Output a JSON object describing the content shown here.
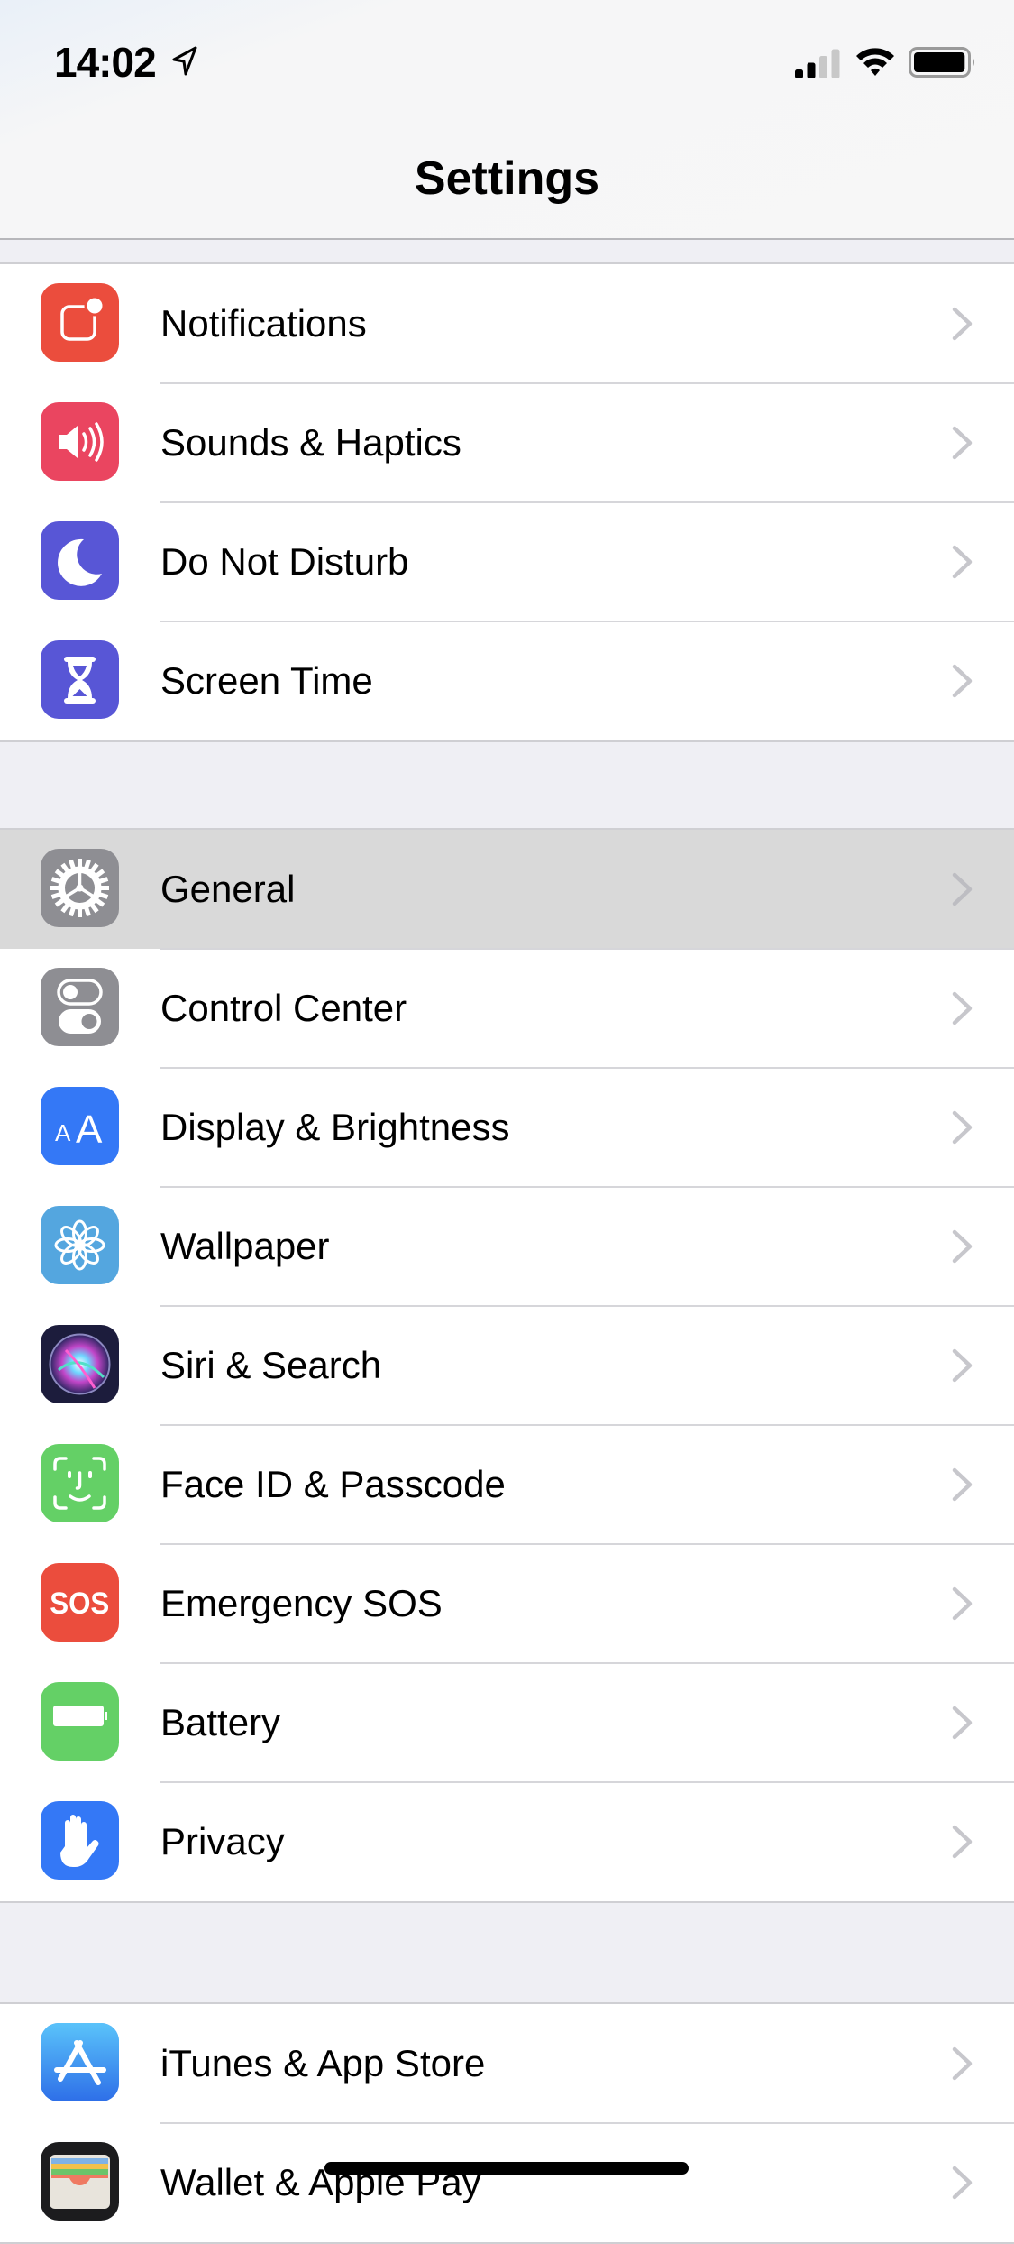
{
  "status_bar": {
    "time": "14:02",
    "location_icon": "location-arrow-icon",
    "signal_bars_active": 2,
    "signal_bars_total": 4,
    "wifi_icon": "wifi-icon",
    "battery_level": 0.9
  },
  "header": {
    "title": "Settings"
  },
  "colors": {
    "background": "#efeff4",
    "highlight": "#d9d9d9",
    "chevron": "#c7c7cc"
  },
  "groups": [
    {
      "items": [
        {
          "label": "Notifications",
          "icon": "notifications-icon",
          "color": "#eb4d3d"
        },
        {
          "label": "Sounds & Haptics",
          "icon": "speaker-icon",
          "color": "#ea4560"
        },
        {
          "label": "Do Not Disturb",
          "icon": "moon-icon",
          "color": "#5856d6"
        },
        {
          "label": "Screen Time",
          "icon": "hourglass-icon",
          "color": "#5856d6"
        }
      ]
    },
    {
      "items": [
        {
          "label": "General",
          "icon": "gear-icon",
          "color": "#8e8e93",
          "highlighted": true
        },
        {
          "label": "Control Center",
          "icon": "toggles-icon",
          "color": "#8e8e93"
        },
        {
          "label": "Display & Brightness",
          "icon": "text-size-icon",
          "color": "#3478f6"
        },
        {
          "label": "Wallpaper",
          "icon": "flower-icon",
          "color": "#54a6df"
        },
        {
          "label": "Siri & Search",
          "icon": "siri-icon",
          "color": "#1c1c3c"
        },
        {
          "label": "Face ID & Passcode",
          "icon": "face-id-icon",
          "color": "#64d066"
        },
        {
          "label": "Emergency SOS",
          "icon": "sos-icon",
          "color": "#eb4d3d"
        },
        {
          "label": "Battery",
          "icon": "battery-icon",
          "color": "#64d066"
        },
        {
          "label": "Privacy",
          "icon": "hand-icon",
          "color": "#3478f6"
        }
      ]
    },
    {
      "items": [
        {
          "label": "iTunes & App Store",
          "icon": "app-store-icon",
          "color": "#3b8df2"
        },
        {
          "label": "Wallet & Apple Pay",
          "icon": "wallet-icon",
          "color": "#1c1c1e"
        }
      ]
    }
  ]
}
